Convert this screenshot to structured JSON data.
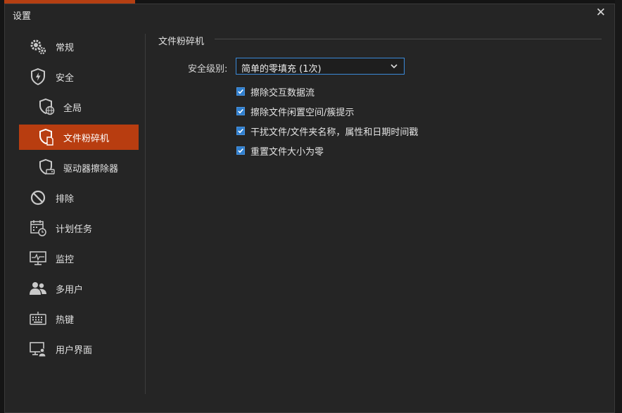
{
  "window": {
    "title": "设置"
  },
  "sidebar": {
    "items": [
      {
        "label": "常规",
        "icon": "gears-icon",
        "level": "top",
        "active": false
      },
      {
        "label": "安全",
        "icon": "shield-bolt-icon",
        "level": "top",
        "active": false
      },
      {
        "label": "全局",
        "icon": "shield-globe-icon",
        "level": "sub",
        "active": false
      },
      {
        "label": "文件粉碎机",
        "icon": "shield-file-icon",
        "level": "sub",
        "active": true
      },
      {
        "label": "驱动器擦除器",
        "icon": "shield-drive-icon",
        "level": "sub",
        "active": false
      },
      {
        "label": "排除",
        "icon": "prohibit-icon",
        "level": "top",
        "active": false
      },
      {
        "label": "计划任务",
        "icon": "calendar-clock-icon",
        "level": "top",
        "active": false
      },
      {
        "label": "监控",
        "icon": "monitor-pulse-icon",
        "level": "top",
        "active": false
      },
      {
        "label": "多用户",
        "icon": "users-icon",
        "level": "top",
        "active": false
      },
      {
        "label": "热键",
        "icon": "keyboard-icon",
        "level": "top",
        "active": false
      },
      {
        "label": "用户界面",
        "icon": "monitor-user-icon",
        "level": "top",
        "active": false
      }
    ]
  },
  "main": {
    "section_title": "文件粉碎机",
    "security_level": {
      "label": "安全级别:",
      "value": "简单的零填充 (1次)"
    },
    "options": [
      {
        "label": "擦除交互数据流",
        "checked": true
      },
      {
        "label": "擦除文件闲置空间/簇提示",
        "checked": true
      },
      {
        "label": "干扰文件/文件夹名称，属性和日期时间戳",
        "checked": true
      },
      {
        "label": "重置文件大小为零",
        "checked": true
      }
    ]
  },
  "colors": {
    "accent": "#b83d10",
    "checkbox": "#2f7fcf",
    "focus_border": "#3b8ad9"
  }
}
